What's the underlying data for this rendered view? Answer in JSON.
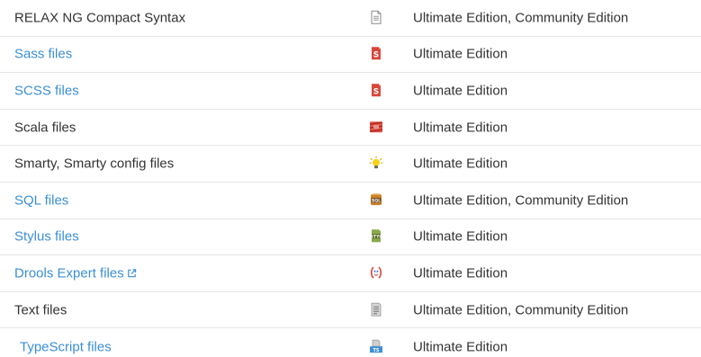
{
  "rows": [
    {
      "name": "RELAX NG Compact Syntax",
      "is_link": false,
      "icon": "document-icon",
      "edition": "Ultimate Edition, Community Edition"
    },
    {
      "name": "Sass files",
      "is_link": true,
      "icon": "sass-file-icon",
      "edition": "Ultimate Edition"
    },
    {
      "name": "SCSS files",
      "is_link": true,
      "icon": "scss-file-icon",
      "edition": "Ultimate Edition"
    },
    {
      "name": "Scala files",
      "is_link": false,
      "icon": "scala-file-icon",
      "edition": "Ultimate Edition"
    },
    {
      "name": "Smarty, Smarty config files",
      "is_link": false,
      "icon": "smarty-file-icon",
      "edition": "Ultimate Edition"
    },
    {
      "name": "SQL files",
      "is_link": true,
      "icon": "sql-file-icon",
      "edition": "Ultimate Edition, Community Edition"
    },
    {
      "name": "Stylus files",
      "is_link": true,
      "icon": "stylus-file-icon",
      "edition": "Ultimate Edition"
    },
    {
      "name": "Drools Expert files",
      "is_link": true,
      "external": true,
      "icon": "drools-file-icon",
      "edition": "Ultimate Edition"
    },
    {
      "name": "Text files",
      "is_link": false,
      "icon": "text-file-icon",
      "edition": "Ultimate Edition, Community Edition"
    },
    {
      "name": "TypeScript files",
      "is_link": true,
      "icon": "typescript-file-icon",
      "edition": "Ultimate Edition"
    }
  ],
  "colors": {
    "link": "#3b8fd4",
    "text": "#333333",
    "divider": "#e6e6e6"
  }
}
